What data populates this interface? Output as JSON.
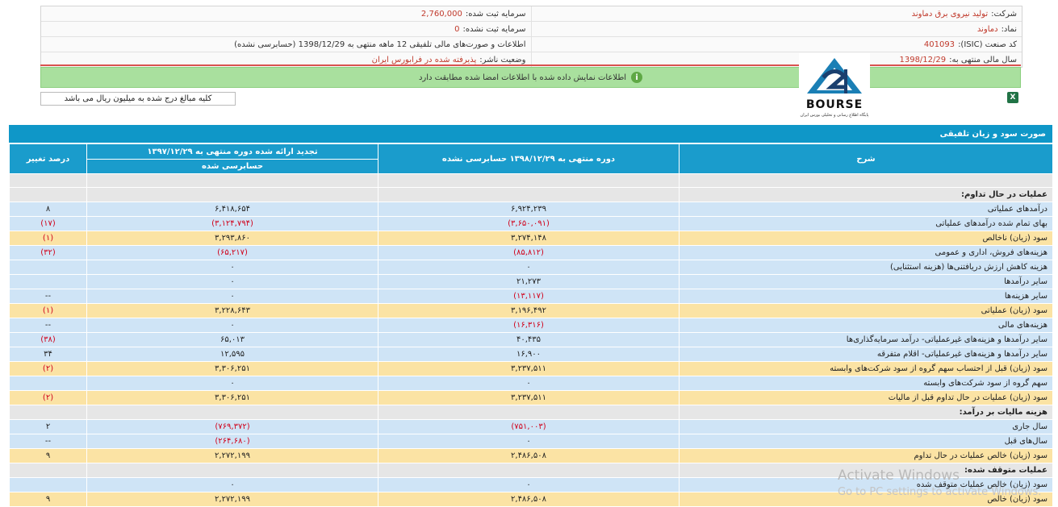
{
  "info": {
    "company_label": "شرکت:",
    "company_value": "تولید نیروی برق دماوند",
    "capital_label": "سرمایه ثبت شده:",
    "capital_value": "2,760,000",
    "symbol_label": "نماد:",
    "symbol_value": "دماوند",
    "unregistered_label": "سرمایه ثبت نشده:",
    "unregistered_value": "0",
    "isic_label": "کد صنعت (ISIC):",
    "isic_value": "401093",
    "statements_label": "اطلاعات و صورت‌های مالی تلفیقی 12 ماهه منتهی به 1398/12/29 (حسابرسی نشده)",
    "fiscal_label": "سال مالی منتهی به:",
    "fiscal_value": "1398/12/29",
    "status_label": "وضعیت ناشر:",
    "status_value": "پذیرفته شده در فرابورس ایران"
  },
  "banner_text": "اطلاعات نمایش داده شده با اطلاعات امضا شده مطابقت دارد",
  "unit_text": "کلیه مبالغ درج شده به میلیون ریال می باشد",
  "logo": {
    "text": "BOURSE",
    "subtext": "پایگاه اطلاع رسانی و تحلیلی بورس ایران"
  },
  "section_title": "صورت سود و زیان تلفیقی",
  "table": {
    "headers": {
      "desc": "شرح",
      "current": "دوره منتهی به ۱۳۹۸/۱۲/۲۹ حسابرسی نشده",
      "previous": "تجدید ارائه شده دوره منتهی به ۱۳۹۷/۱۲/۲۹",
      "previous_sub": "حسابرسی شده",
      "change": "درصد تغییر"
    },
    "rows": [
      {
        "label": "عملیات در حال تداوم:",
        "current": "",
        "previous": "",
        "change": ""
      },
      {
        "label": "درآمدهای عملیاتی",
        "current": "۶,۹۲۴,۲۳۹",
        "previous": "۶,۴۱۸,۶۵۴",
        "change": "۸"
      },
      {
        "label": "بهای تمام شده درآمدهای عملیاتی",
        "current": "(۳,۶۵۰,۰۹۱)",
        "previous": "(۳,۱۲۴,۷۹۴)",
        "change": "(۱۷)"
      },
      {
        "label": "سود (زیان) ناخالص",
        "current": "۳,۲۷۴,۱۴۸",
        "previous": "۳,۲۹۳,۸۶۰",
        "change": "(۱)"
      },
      {
        "label": "هزینه‌های فروش، اداری و عمومی",
        "current": "(۸۵,۸۱۲)",
        "previous": "(۶۵,۲۱۷)",
        "change": "(۳۲)"
      },
      {
        "label": "هزینه کاهش ارزش دریافتنی‌ها (هزینه استثنایی)",
        "current": "۰",
        "previous": "۰",
        "change": ""
      },
      {
        "label": "سایر درآمدها",
        "current": "۲۱,۲۷۳",
        "previous": "۰",
        "change": ""
      },
      {
        "label": "سایر هزینه‌ها",
        "current": "(۱۳,۱۱۷)",
        "previous": "۰",
        "change": "--"
      },
      {
        "label": "سود (زیان) عملیاتی",
        "current": "۳,۱۹۶,۴۹۲",
        "previous": "۳,۲۲۸,۶۴۳",
        "change": "(۱)"
      },
      {
        "label": "هزینه‌های مالی",
        "current": "(۱۶,۳۱۶)",
        "previous": "۰",
        "change": "--"
      },
      {
        "label": "سایر درآمدها و هزینه‌های غیرعملیاتی- درآمد سرمایه‌گذاری‌ها",
        "current": "۴۰,۴۳۵",
        "previous": "۶۵,۰۱۳",
        "change": "(۳۸)"
      },
      {
        "label": "سایر درآمدها و هزینه‌های غیرعملیاتی- اقلام متفرقه",
        "current": "۱۶,۹۰۰",
        "previous": "۱۲,۵۹۵",
        "change": "۳۴"
      },
      {
        "label": "سود (زیان) قبل از احتساب سهم گروه از سود شرکت‌های وابسته",
        "current": "۳,۲۳۷,۵۱۱",
        "previous": "۳,۳۰۶,۲۵۱",
        "change": "(۲)"
      },
      {
        "label": "سهم گروه از سود شرکت‌های وابسته",
        "current": "۰",
        "previous": "۰",
        "change": ""
      },
      {
        "label": "سود (زیان) عملیات در حال تداوم قبل از مالیات",
        "current": "۳,۲۳۷,۵۱۱",
        "previous": "۳,۳۰۶,۲۵۱",
        "change": "(۲)"
      },
      {
        "label": "هزینه مالیات بر درآمد:",
        "current": "",
        "previous": "",
        "change": ""
      },
      {
        "label": "سال جاری",
        "current": "(۷۵۱,۰۰۳)",
        "previous": "(۷۶۹,۳۷۲)",
        "change": "۲"
      },
      {
        "label": "سال‌های قبل",
        "current": "۰",
        "previous": "(۲۶۴,۶۸۰)",
        "change": "--"
      },
      {
        "label": "سود (زیان) خالص عملیات در حال تداوم",
        "current": "۲,۴۸۶,۵۰۸",
        "previous": "۲,۲۷۲,۱۹۹",
        "change": "۹"
      },
      {
        "label": "عملیات متوقف شده:",
        "current": "",
        "previous": "",
        "change": ""
      },
      {
        "label": "سود (زیان) خالص عملیات متوقف شده",
        "current": "۰",
        "previous": "۰",
        "change": ""
      },
      {
        "label": "سود (زیان) خالص",
        "current": "۲,۴۸۶,۵۰۸",
        "previous": "۲,۲۷۲,۱۹۹",
        "change": "۹"
      }
    ]
  },
  "watermark": {
    "line1": "Activate Windows",
    "line2": "Go to PC settings to activate Windows."
  },
  "colors": {
    "accent": "#0f97c8",
    "negative": "#d0021b",
    "banner": "#a9e09e"
  }
}
